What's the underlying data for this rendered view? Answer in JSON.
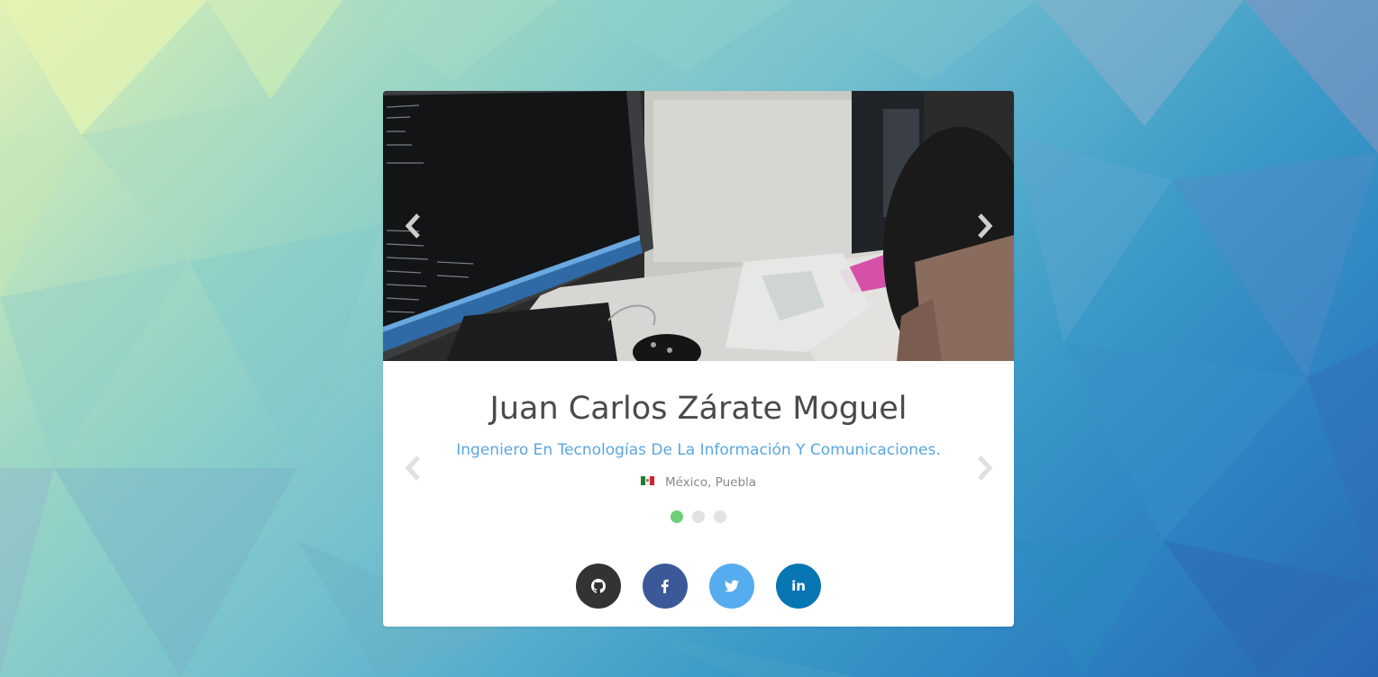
{
  "profile": {
    "name": "Juan Carlos Zárate Moguel",
    "role": "Ingeniero En Tecnologías De La Información Y Comunicaciones.",
    "location": "México, Puebla",
    "flag_icon": "mexico-flag-icon"
  },
  "carousel": {
    "slide_count": 3,
    "active_index": 0,
    "prev_icon": "chevron-left-icon",
    "next_icon": "chevron-right-icon"
  },
  "socials": [
    {
      "name": "github",
      "icon": "github-icon",
      "color": "#333333"
    },
    {
      "name": "facebook",
      "icon": "facebook-icon",
      "color": "#3b5998"
    },
    {
      "name": "twitter",
      "icon": "twitter-icon",
      "color": "#55acee"
    },
    {
      "name": "linkedin",
      "icon": "linkedin-icon",
      "color": "#0976b4",
      "glyph": "in"
    }
  ],
  "colors": {
    "name_text": "#4a4a4a",
    "role_text": "#5aa7de",
    "active_dot": "#6dcf75",
    "inactive_dot": "#e2e2e2"
  }
}
